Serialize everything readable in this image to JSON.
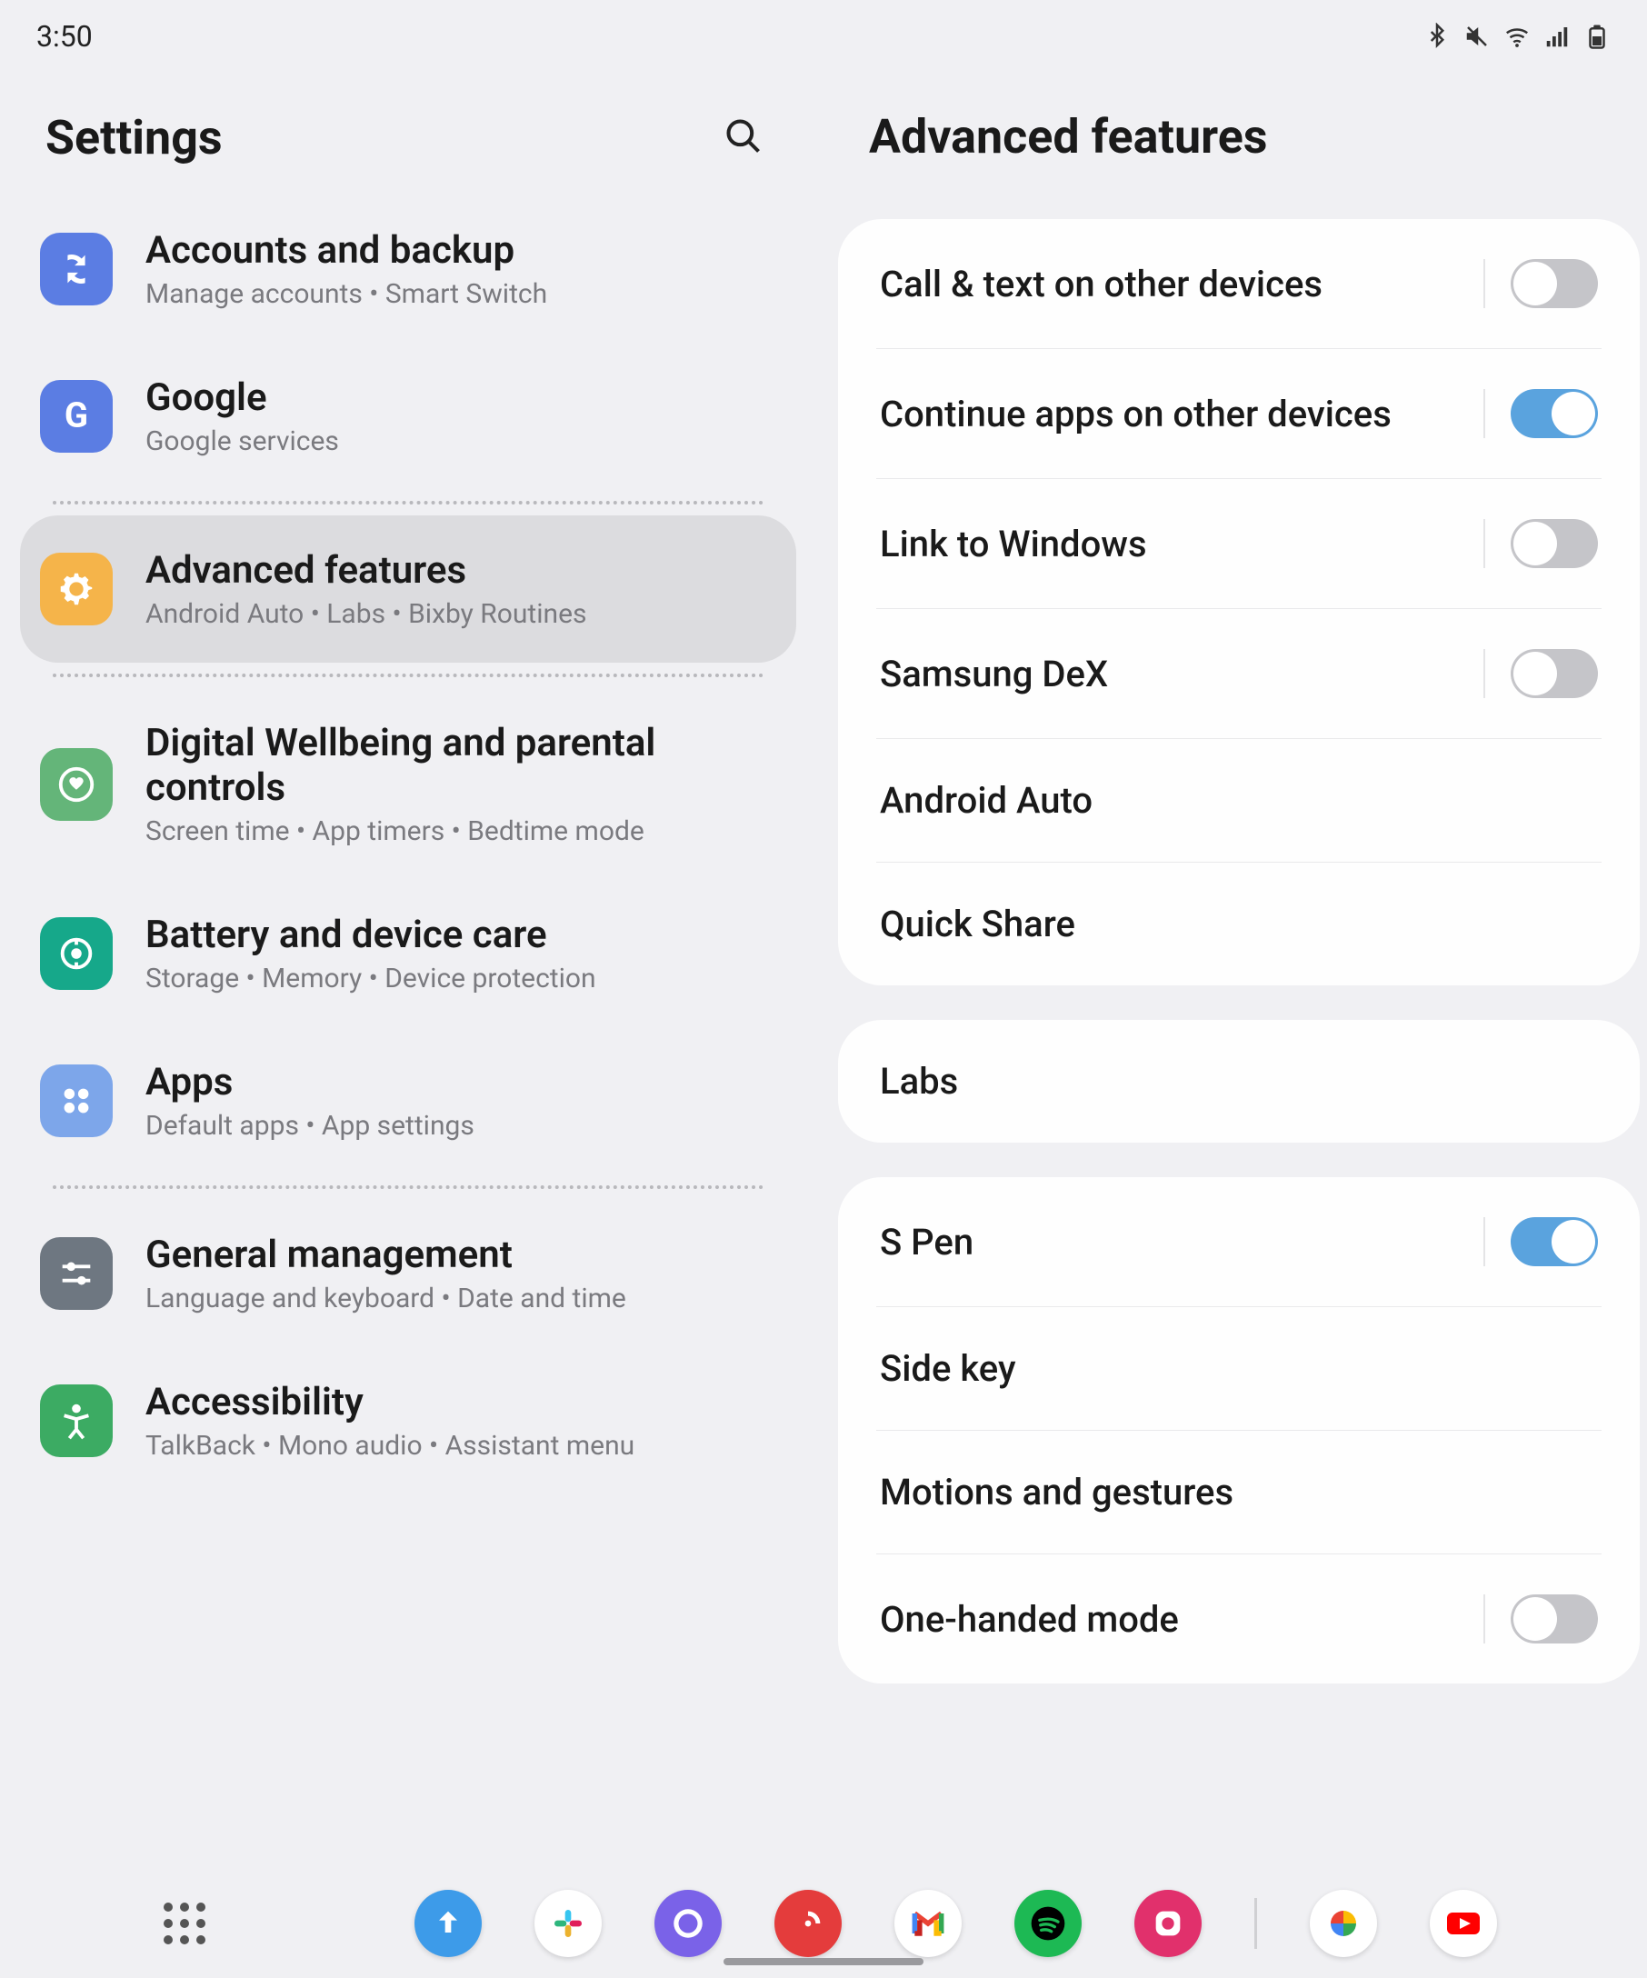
{
  "status": {
    "time": "3:50"
  },
  "left": {
    "title": "Settings",
    "items": [
      {
        "icon": "sync",
        "color": "ic-blue",
        "title": "Accounts and backup",
        "sub": "Manage accounts  •  Smart Switch",
        "clip": true
      },
      {
        "icon": "g",
        "color": "ic-google",
        "title": "Google",
        "sub": "Google services"
      },
      "divider",
      {
        "icon": "gear",
        "color": "ic-orange",
        "title": "Advanced features",
        "sub": "Android Auto  •  Labs  •  Bixby Routines",
        "selected": true
      },
      "divider",
      {
        "icon": "heart",
        "color": "ic-green",
        "title": "Digital Wellbeing and parental controls",
        "sub": "Screen time  •  App timers  •  Bedtime mode"
      },
      {
        "icon": "care",
        "color": "ic-teal",
        "title": "Battery and device care",
        "sub": "Storage  •  Memory  •  Device protection"
      },
      {
        "icon": "apps",
        "color": "ic-lblue",
        "title": "Apps",
        "sub": "Default apps  •  App settings"
      },
      "divider",
      {
        "icon": "slide",
        "color": "ic-gray",
        "title": "General management",
        "sub": "Language and keyboard  •  Date and time"
      },
      {
        "icon": "a11y",
        "color": "ic-dgreen",
        "title": "Accessibility",
        "sub": "TalkBack  •  Mono audio  •  Assistant menu"
      }
    ]
  },
  "right": {
    "title": "Advanced features",
    "groups": [
      [
        {
          "label": "Call & text on other devices",
          "toggle": false
        },
        {
          "label": "Continue apps on other devices",
          "toggle": true
        },
        {
          "label": "Link to Windows",
          "toggle": false
        },
        {
          "label": "Samsung DeX",
          "toggle": false
        },
        {
          "label": "Android Auto"
        },
        {
          "label": "Quick Share"
        }
      ],
      [
        {
          "label": "Labs"
        }
      ],
      [
        {
          "label": "S Pen",
          "toggle": true
        },
        {
          "label": "Side key"
        },
        {
          "label": "Motions and gestures"
        },
        {
          "label": "One-handed mode",
          "toggle": false
        }
      ]
    ]
  },
  "dock": {
    "apps": [
      "upload",
      "slack",
      "internet",
      "pocketcasts",
      "gmail",
      "spotify",
      "instagram",
      "sep",
      "photos",
      "youtube"
    ]
  }
}
